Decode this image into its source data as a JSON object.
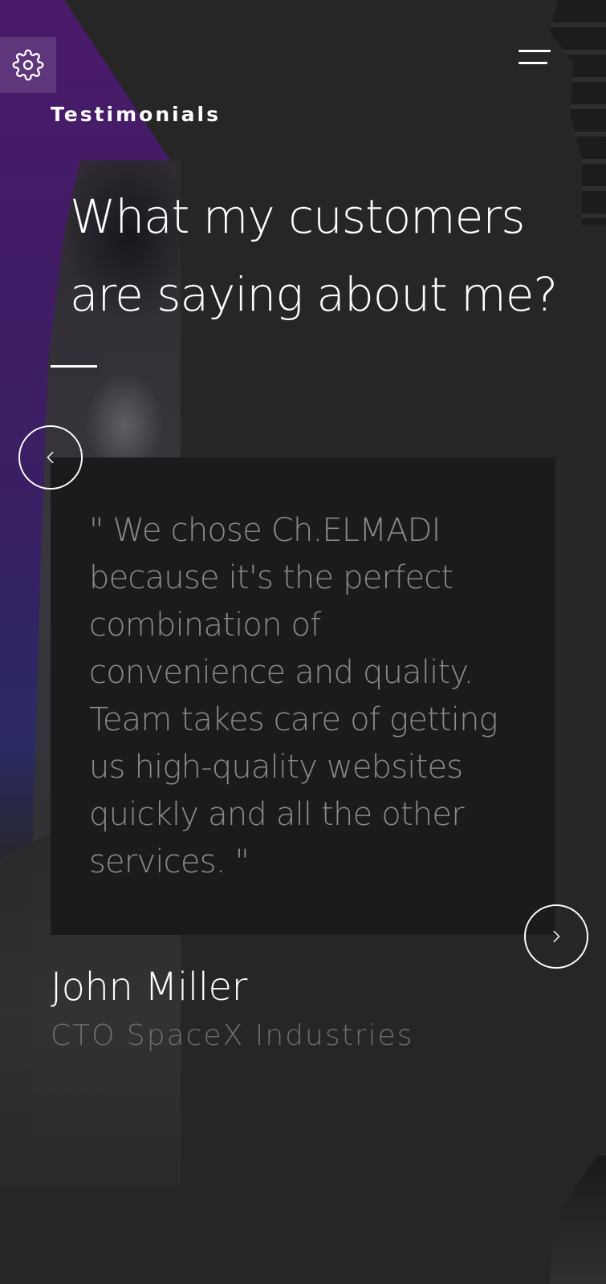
{
  "header": {
    "settings_icon": "gear-icon",
    "menu_icon": "hamburger-menu-icon"
  },
  "section": {
    "label": "Testimonials",
    "headline_line1": "What my customers",
    "headline_line2": "are saying about me?"
  },
  "testimonial": {
    "quote": "\" We chose Ch.ELMADI because it's the perfect combination of convenience and quality. Team takes care of getting us high-quality websites quickly and all the other services. \"",
    "author_name": "John Miller",
    "author_role": "CTO SpaceX Industries"
  },
  "controls": {
    "prev_icon": "chevron-left-icon",
    "next_icon": "chevron-right-icon"
  },
  "colors": {
    "background": "#262626",
    "card": "#1b1b1b",
    "accent_purple": "#4a1a6a",
    "text_primary": "#ffffff",
    "text_muted": "#8a8a8a"
  }
}
